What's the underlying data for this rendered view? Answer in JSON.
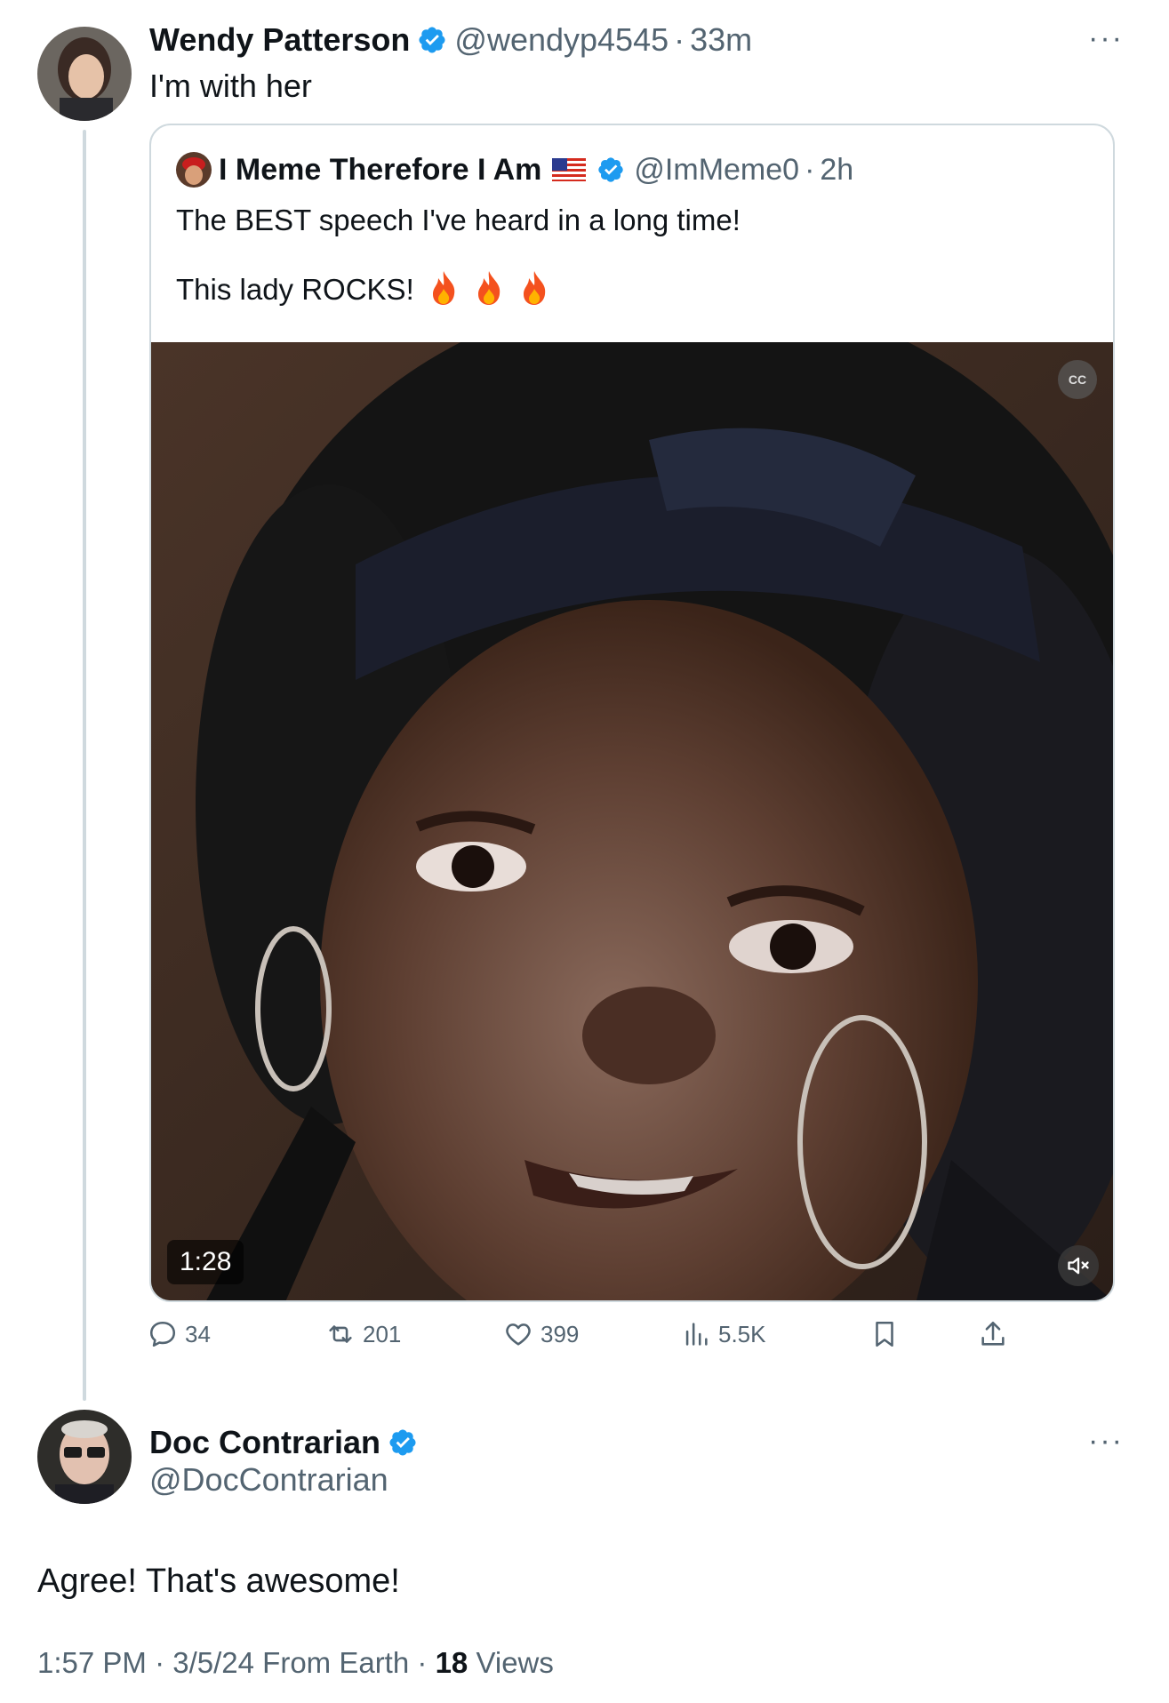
{
  "reply_to": {
    "author_name": "Wendy Patterson",
    "handle": "@wendyp4545",
    "separator": "·",
    "time": "33m",
    "text": "I'm with her",
    "more": "···"
  },
  "quoted": {
    "author_name": "I Meme Therefore I Am",
    "handle": "@ImMeme0",
    "separator": "·",
    "time": "2h",
    "text_line1": "The BEST speech I've heard in a long time!",
    "text_line2": "This lady ROCKS!",
    "video": {
      "duration": "1:28",
      "cc_label": "CC"
    }
  },
  "engagement": {
    "replies": "34",
    "reposts": "201",
    "likes": "399",
    "views": "5.5K"
  },
  "main_post": {
    "author_name": "Doc Contrarian",
    "handle": "@DocContrarian",
    "text": "Agree! That's awesome!",
    "more": "···",
    "time": "1:57 PM",
    "date": "3/5/24",
    "source": "From Earth",
    "views_count": "18",
    "views_label": "Views",
    "separator": "·"
  },
  "colors": {
    "verified": "#1d9bf0",
    "secondary_text": "#536471",
    "border": "#cfd9de"
  },
  "icons": [
    "verified-icon",
    "more-icon",
    "flag-icon",
    "fire-icon",
    "cc-icon",
    "mute-icon",
    "reply-icon",
    "repost-icon",
    "like-icon",
    "views-icon",
    "bookmark-icon",
    "share-icon"
  ]
}
